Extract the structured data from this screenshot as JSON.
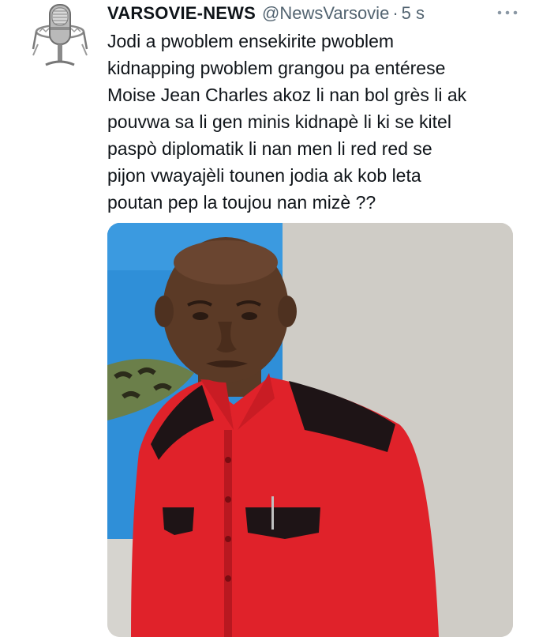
{
  "tweet": {
    "author_name": "VARSOVIE-NEWS",
    "handle": "@NewsVarsovie",
    "separator": "·",
    "time": "5 s",
    "avatar_icon": "studio-microphone-icon",
    "more_icon": "more-horizontal-icon",
    "text_lines": [
      "Jodi a pwoblem ensekirite pwoblem",
      "kidnapping pwoblem grangou pa entérese",
      "Moise Jean Charles akoz li nan bol grès li ak",
      "pouvwa sa li gen minis kidnapè li ki se kitel",
      "paspò diplomatik li nan men li red red se",
      "pijon vwayajèli tounen jodia ak kob leta",
      "poutan pep la toujou nan mizè ??"
    ],
    "media_icon": "photo-man-red-shirt"
  },
  "colors": {
    "text_primary": "#0f1419",
    "text_secondary": "#536471",
    "shirt_red": "#e0222a",
    "wall_blue": "#2f8fd8"
  }
}
